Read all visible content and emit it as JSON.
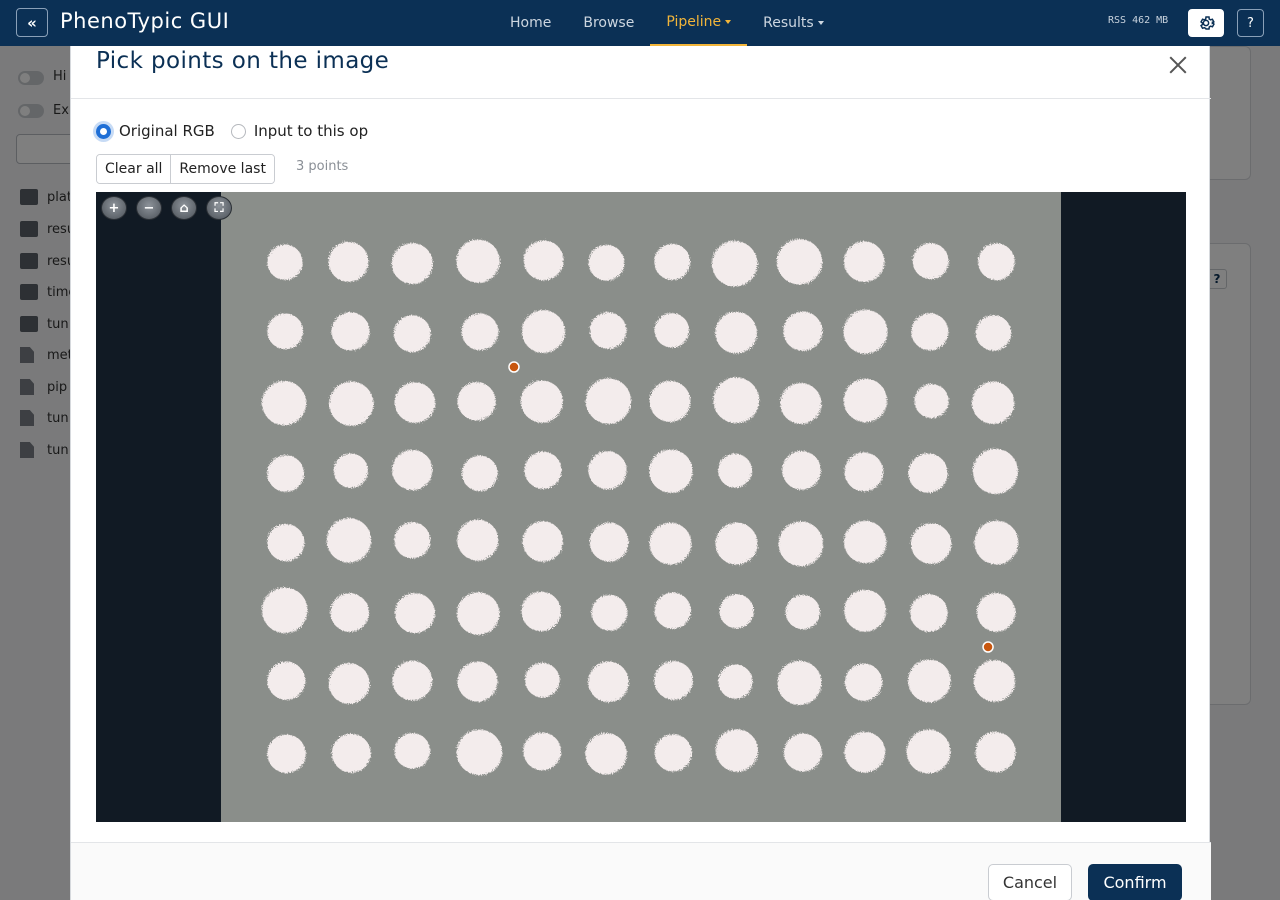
{
  "navbar": {
    "brand": "PhenoTypic GUI",
    "collapse_icon": "«",
    "links": [
      {
        "label": "Home",
        "active": false,
        "dropdown": false
      },
      {
        "label": "Browse",
        "active": false,
        "dropdown": false
      },
      {
        "label": "Pipeline",
        "active": true,
        "dropdown": true
      },
      {
        "label": "Results",
        "active": false,
        "dropdown": true
      }
    ],
    "rss": "RSS 462 MB",
    "help_label": "?"
  },
  "background": {
    "toggles": [
      "Hi",
      "Ex"
    ],
    "files": [
      {
        "name": "plat",
        "type": "folder"
      },
      {
        "name": "resu",
        "type": "folder"
      },
      {
        "name": "resu",
        "type": "folder"
      },
      {
        "name": "time",
        "type": "folder"
      },
      {
        "name": "tun",
        "type": "folder"
      },
      {
        "name": "met",
        "type": "file"
      },
      {
        "name": "pip",
        "type": "file"
      },
      {
        "name": "tun",
        "type": "file"
      },
      {
        "name": "tun",
        "type": "file"
      }
    ],
    "right_help": "?"
  },
  "modal": {
    "title": "Pick points on the image",
    "radio_options": [
      {
        "label": "Original RGB",
        "checked": true
      },
      {
        "label": "Input to this op",
        "checked": false
      }
    ],
    "clear_label": "Clear all",
    "remove_label": "Remove last",
    "points_text": "3 points",
    "tools": [
      {
        "name": "zoom-in-icon",
        "glyph": "+"
      },
      {
        "name": "zoom-out-icon",
        "glyph": "−"
      },
      {
        "name": "home-icon",
        "glyph": "⌂"
      },
      {
        "name": "fullscreen-icon",
        "glyph": "⛶"
      }
    ],
    "plate": {
      "rows": 8,
      "cols": 12,
      "colony_color": "#f3ecec",
      "plate_color": "#8a8e8a",
      "background_color": "#111a24"
    },
    "points": [
      {
        "row": 1.5,
        "col": 3.55
      },
      {
        "row": 5.5,
        "col": 10.9
      }
    ],
    "point_color": "#c8570f",
    "cancel_label": "Cancel",
    "confirm_label": "Confirm"
  }
}
